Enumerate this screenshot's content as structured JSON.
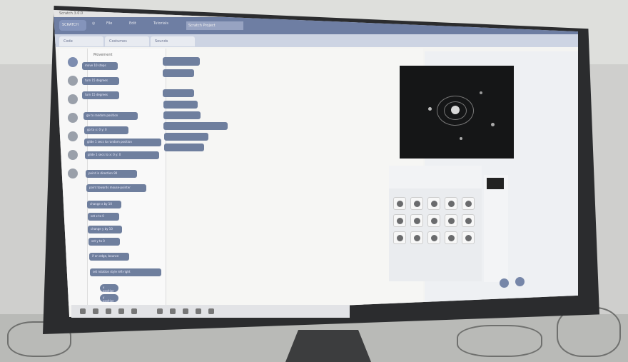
{
  "app": {
    "title": "Scratch 3.0.0",
    "logo_text": "SCRATCH",
    "menu": [
      "File",
      "Edit",
      "Tutorials"
    ],
    "project_title": "Scratch Project"
  },
  "tabs": [
    "Code",
    "Costumes",
    "Sounds"
  ],
  "palette": {
    "heading": "Movement",
    "blocks": [
      "move 10 steps",
      "turn 15 degrees",
      "turn 15 degrees",
      "go to random position",
      "go to x: 0 y: 0",
      "glide 1 secs to random position",
      "glide 1 secs to x: 0 y: 0",
      "point in direction 90",
      "point towards mouse-pointer",
      "change x by 10",
      "set x to 0",
      "change y by 10",
      "set y to 0",
      "if on edge, bounce",
      "set rotation style left-right",
      "x position",
      "y position"
    ]
  },
  "stage": {
    "sprites_count": 15
  },
  "colors": {
    "accent": "#6e7ea3",
    "stage_bg": "#151617"
  }
}
